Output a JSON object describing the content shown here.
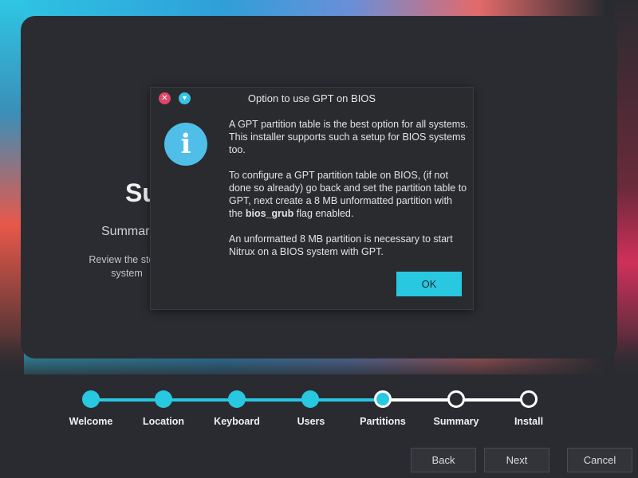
{
  "background_card": {
    "title_partial": "Su",
    "subtitle_partial": "Summar",
    "description_partial_1": "Review the steps",
    "description_partial_2": "system"
  },
  "dialog": {
    "title": "Option to use GPT on BIOS",
    "icon": "info-icon",
    "paragraph_1": "A GPT partition table is the best option for all systems. This installer supports such a setup for BIOS systems too.",
    "paragraph_2_before": "To configure a GPT partition table on BIOS, (if not done so already) go back and set the partition table to GPT, next create a 8 MB unformatted partition with the ",
    "paragraph_2_bold": "bios_grub",
    "paragraph_2_after": " flag enabled.",
    "paragraph_3": "An unformatted 8 MB partition is necessary to start Nitrux on a BIOS system with GPT.",
    "ok_label": "OK"
  },
  "stepper": {
    "steps": [
      {
        "label": "Welcome",
        "state": "done"
      },
      {
        "label": "Location",
        "state": "done"
      },
      {
        "label": "Keyboard",
        "state": "done"
      },
      {
        "label": "Users",
        "state": "done"
      },
      {
        "label": "Partitions",
        "state": "current"
      },
      {
        "label": "Summary",
        "state": "todo"
      },
      {
        "label": "Install",
        "state": "todo"
      }
    ]
  },
  "nav": {
    "back_label": "Back",
    "next_label": "Next",
    "cancel_label": "Cancel"
  },
  "colors": {
    "accent": "#27c8e0",
    "close": "#e0466a",
    "info": "#4fbfea"
  }
}
